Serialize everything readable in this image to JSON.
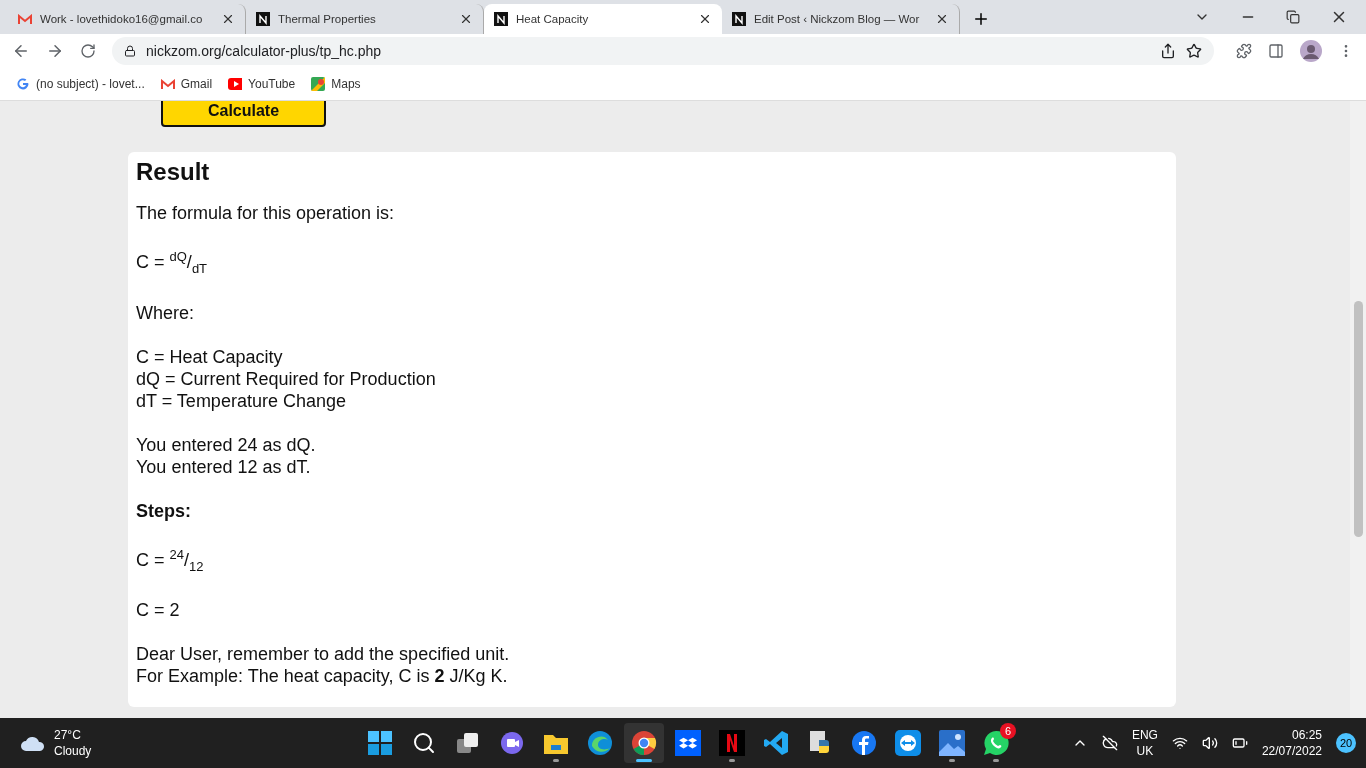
{
  "tabs": [
    {
      "kind": "mail",
      "label": "Work - lovethidoko16@gmail.co",
      "selected": false
    },
    {
      "kind": "site",
      "label": "Thermal Properties",
      "selected": false
    },
    {
      "kind": "site",
      "label": "Heat Capacity",
      "selected": true
    },
    {
      "kind": "site",
      "label": "Edit Post ‹ Nickzom Blog — Wor",
      "selected": false
    }
  ],
  "address_bar": {
    "url": "nickzom.org/calculator-plus/tp_hc.php"
  },
  "bookmarks": [
    {
      "kind": "google",
      "label": "(no subject) - lovet..."
    },
    {
      "kind": "mail",
      "label": "Gmail"
    },
    {
      "kind": "video",
      "label": "YouTube"
    },
    {
      "kind": "maps",
      "label": "Maps"
    }
  ],
  "calculate_button": "Calculate",
  "result": {
    "title": "Result",
    "paragraphs": [
      [
        "The formula for this operation is:"
      ],
      [
        "C = $^{dQ}$/$_{dT}$"
      ],
      [
        "Where:"
      ],
      [
        "C = Heat Capacity",
        "dQ = Current Required for Production",
        "dT = Temperature Change"
      ],
      [
        "You entered 24 as dQ.",
        "You entered 12 as dT."
      ],
      [
        "**Steps:**"
      ],
      [
        "C = $^{24}$/$_{12}$"
      ],
      [
        "C = 2"
      ],
      [
        "Dear User, remember to add the specified unit.",
        "For Example: The heat capacity, C is **2** J/Kg K."
      ]
    ]
  },
  "taskbar": {
    "weather": {
      "temperature": "27°C",
      "condition": "Cloudy"
    },
    "apps": [
      {
        "kind": "start",
        "running": false,
        "active": false
      },
      {
        "kind": "search",
        "running": false,
        "active": false
      },
      {
        "kind": "taskview",
        "running": false,
        "active": false
      },
      {
        "kind": "chat",
        "running": false,
        "active": false
      },
      {
        "kind": "folder",
        "running": true,
        "active": false
      },
      {
        "kind": "edge",
        "running": false,
        "active": false
      },
      {
        "kind": "chrome",
        "running": true,
        "active": true
      },
      {
        "kind": "dropbox",
        "running": false,
        "active": false
      },
      {
        "kind": "netflix",
        "running": true,
        "active": false
      },
      {
        "kind": "code",
        "running": false,
        "active": false
      },
      {
        "kind": "python",
        "running": false,
        "active": false
      },
      {
        "kind": "facebook",
        "running": false,
        "active": false
      },
      {
        "kind": "remote",
        "running": false,
        "active": false
      },
      {
        "kind": "photos",
        "running": true,
        "active": false
      },
      {
        "kind": "whatsapp",
        "running": true,
        "active": false,
        "badge": "6"
      }
    ],
    "language": "ENG",
    "region": "UK",
    "time": "06:25",
    "date": "22/07/2022",
    "notifications": "20"
  }
}
